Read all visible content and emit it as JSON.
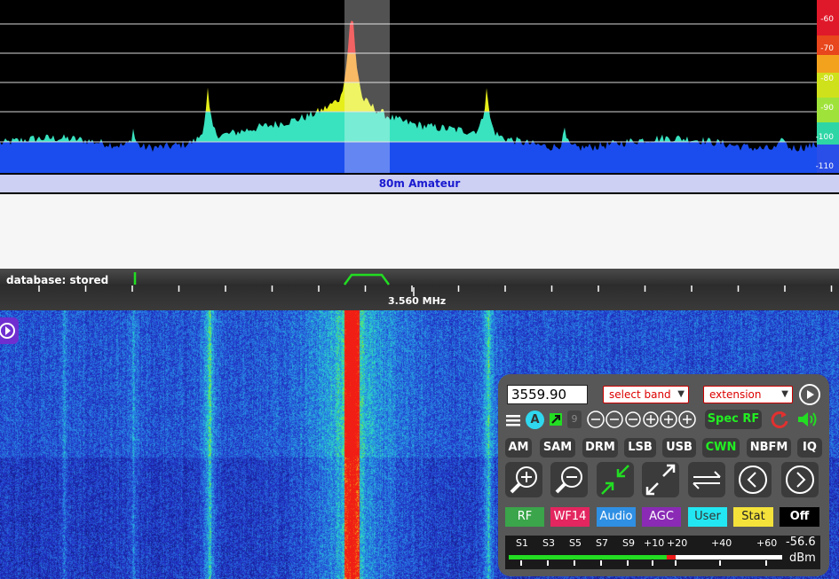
{
  "spectrum": {
    "db_labels": [
      "-60",
      "-70",
      "-80",
      "-90",
      "-100",
      "-110"
    ],
    "colors": {
      "blue": "#1b4dee",
      "cyan": "#39e3c0",
      "yellow": "#e6ef1a",
      "orange": "#f59a1c",
      "red": "#ee1a1a"
    }
  },
  "band_bar": {
    "label": "80m Amateur"
  },
  "scale": {
    "database_status": "database: stored",
    "center_frequency": "3.560 MHz"
  },
  "panel": {
    "frequency_value": "3559.90",
    "select_band": "select band",
    "extension": "extension",
    "icons": [
      "hamburger-icon",
      "a-badge-icon",
      "external-link-icon",
      "step-9-icon",
      "zoom-minus-icons",
      "zoom-plus-icons",
      "reload-icon",
      "speaker-icon"
    ],
    "step_label": "9",
    "a_label": "A",
    "spec_rf": "Spec RF",
    "modes": [
      "AM",
      "SAM",
      "DRM",
      "LSB",
      "USB",
      "CWN",
      "NBFM",
      "IQ"
    ],
    "active_mode": "CWN",
    "tabs": [
      {
        "label": "RF",
        "bg": "#3aa54a",
        "fg": "#ffffff"
      },
      {
        "label": "WF14",
        "bg": "#e3265f",
        "fg": "#ffffff"
      },
      {
        "label": "Audio",
        "bg": "#2f8fe3",
        "fg": "#ffffff"
      },
      {
        "label": "AGC",
        "bg": "#8a2ab5",
        "fg": "#ffffff"
      },
      {
        "label": "User",
        "bg": "#22e7f2",
        "fg": "#333333"
      },
      {
        "label": "Stat",
        "bg": "#f4e23b",
        "fg": "#222222"
      },
      {
        "label": "Off",
        "bg": "#000000",
        "fg": "#ffffff"
      }
    ],
    "smeter": {
      "labels": [
        "S1",
        "S3",
        "S5",
        "S7",
        "S9",
        "+10",
        "+20",
        "+40",
        "+60"
      ],
      "reading": "-56.6",
      "unit": "dBm",
      "level_fraction": 0.61
    }
  }
}
